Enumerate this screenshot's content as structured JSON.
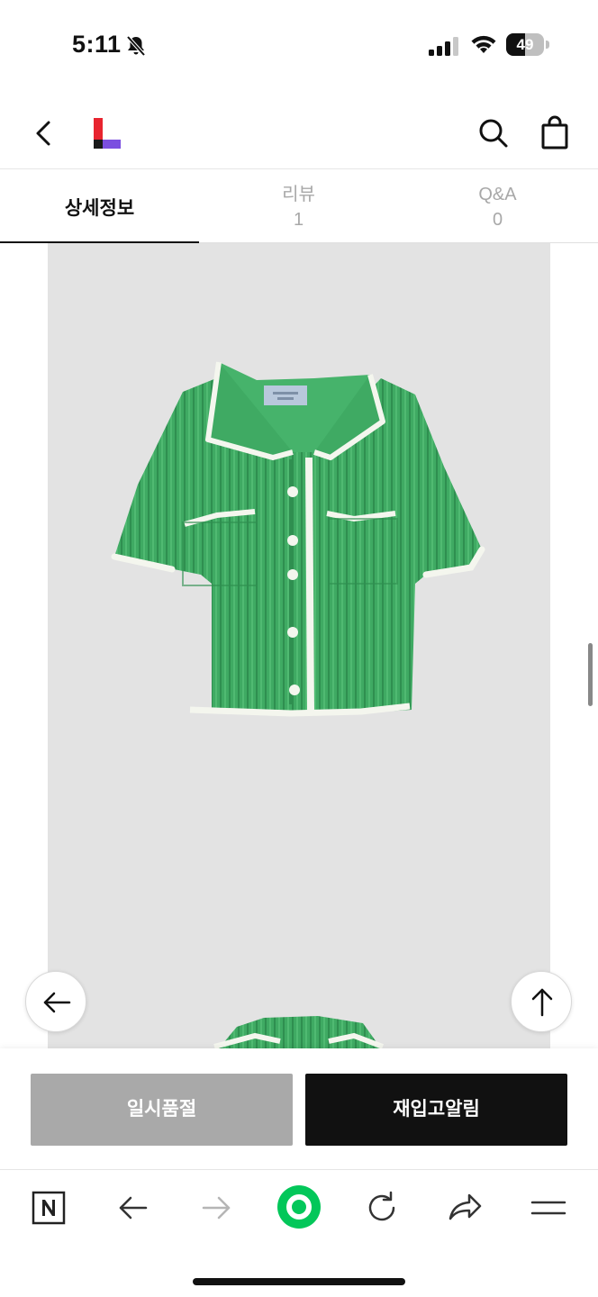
{
  "status_bar": {
    "time": "5:11",
    "battery_level": "49",
    "battery_percent": 49
  },
  "header": {
    "back_icon": "chevron-left-icon",
    "logo_icon": "brand-l-logo",
    "search_icon": "search-icon",
    "cart_icon": "shopping-bag-icon",
    "logo_colors": [
      "#e8242f",
      "#7b4fe0",
      "#1a1a1a"
    ]
  },
  "tabs": [
    {
      "label": "상세정보",
      "count": "",
      "active": true
    },
    {
      "label": "리뷰",
      "count": "1",
      "active": false
    },
    {
      "label": "Q&A",
      "count": "0",
      "active": false
    }
  ],
  "product": {
    "image_icon": "green-knit-cardigan-image",
    "colors": {
      "knit": "#3faa63",
      "trim": "#f4f6ee",
      "background": "#e3e3e3"
    }
  },
  "floating": {
    "back_icon": "arrow-left-icon",
    "top_icon": "arrow-up-icon"
  },
  "actions": {
    "soldout_label": "일시품절",
    "restock_label": "재입고알림"
  },
  "browser_bar": {
    "items": [
      "naver-n-icon",
      "arrow-left-icon",
      "arrow-right-icon",
      "green-home-icon",
      "reload-icon",
      "share-icon",
      "menu-icon"
    ],
    "accent": "#03c75a"
  }
}
